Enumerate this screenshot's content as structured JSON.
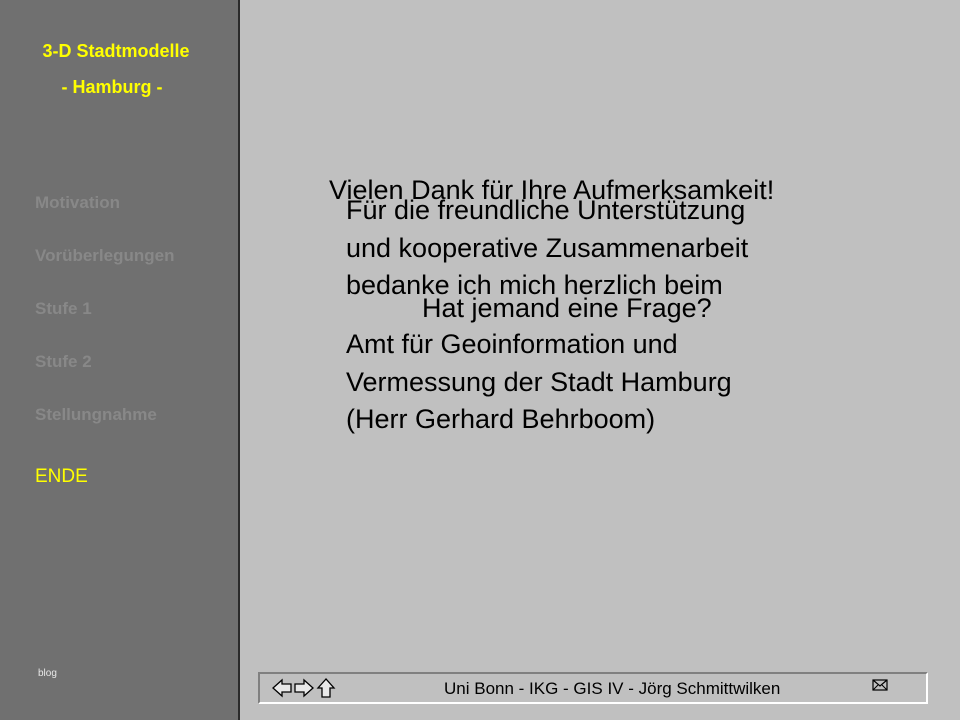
{
  "sidebar": {
    "title": "3-D Stadtmodelle",
    "subtitle": "- Hamburg -",
    "items": [
      {
        "label": "Motivation"
      },
      {
        "label": "Vorüberlegungen"
      },
      {
        "label": "Stufe 1"
      },
      {
        "label": "Stufe 2"
      },
      {
        "label": "Stellungnahme"
      },
      {
        "label": "ENDE"
      }
    ],
    "footer_label": "blog"
  },
  "main": {
    "heading": "Vielen Dank für Ihre Aufmerksamkeit!",
    "thanks_lines": [
      "Für die freundliche Unterstützung",
      "und kooperative Zusammenarbeit",
      "bedanke ich mich herzlich beim"
    ],
    "question": "Hat jemand eine Frage?",
    "org_lines": [
      "Amt für Geoinformation und",
      "Vermessung der Stadt Hamburg",
      "(Herr Gerhard Behrboom)"
    ]
  },
  "footer": {
    "credit": "Uni Bonn  -  IKG  -  GIS IV  -  Jörg Schmittwilken",
    "icons": [
      "arrow-left-icon",
      "arrow-right-icon",
      "arrow-up-icon",
      "mail-icon"
    ]
  },
  "colors": {
    "sidebar_bg": "#707070",
    "main_bg": "#c0c0c0",
    "accent": "#ffff00",
    "nav_inactive": "#888888"
  }
}
